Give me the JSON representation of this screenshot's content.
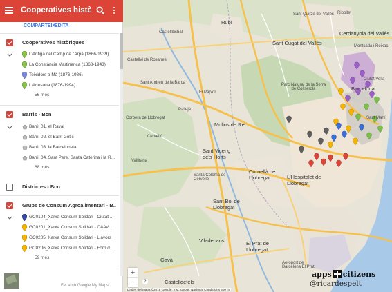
{
  "app": {
    "title": "Cooperatives històriq",
    "actions": {
      "share": "COMPARTEIX",
      "edit": "EDITA"
    }
  },
  "layers": [
    {
      "name": "Cooperatives històriques",
      "checked": true,
      "items": [
        {
          "label": "L'Antiga del Camp de l'Arpa (1866-1939)",
          "color": "#8bc34a"
        },
        {
          "label": "La Constància Martinenca (1868-1943)",
          "color": "#8bc34a"
        },
        {
          "label": "Teixidors a Mà (1876-1986)",
          "color": "#7e86d6"
        },
        {
          "label": "L'Artesana (1876-1994)",
          "color": "#8bc34a"
        }
      ],
      "more": "56 més"
    },
    {
      "name": "Barris - Bcn",
      "checked": true,
      "items": [
        {
          "label": "Barri: 01. el Raval",
          "color": "#bdbdbd"
        },
        {
          "label": "Barri: 02. el Barri Gòtic",
          "color": "#bdbdbd"
        },
        {
          "label": "Barri: 03. la Barceloneta",
          "color": "#bdbdbd"
        },
        {
          "label": "Barri: 04. Sant Pere, Santa Caterina i la R...",
          "color": "#bdbdbd"
        }
      ],
      "more": "68 més"
    },
    {
      "name": "Districtes - Bcn",
      "checked": false,
      "items": [],
      "more": ""
    },
    {
      "name": "Grups de Consum Agroalimentari - B...",
      "checked": true,
      "items": [
        {
          "label": "GC0104_Xarxa Consum Solidari - Ciutat ...",
          "color": "#3949ab"
        },
        {
          "label": "GC0201_Xarxa Consum Solidari - CAAV...",
          "color": "#f4b400"
        },
        {
          "label": "GC0205_Xarxa Consum Solidari - Llavors",
          "color": "#f4b400"
        },
        {
          "label": "GC0206_Xarxa Consum Solidari - Forn d...",
          "color": "#f4b400"
        }
      ],
      "more": "59 més"
    }
  ],
  "footer": {
    "text": "Fet amb Google My Maps"
  },
  "map": {
    "labels": {
      "rubi": "Rubí",
      "castellbisbal": "Castellbisbal",
      "sant_quirze": "Sant Quirze del Vallès",
      "sant_cugat": "Sant Cugat del Vallès",
      "cerdanyola": "Cerdanyola del Vallès",
      "ripollet": "Ripollet",
      "montcada": "Montcada i Reixac",
      "el_papiol": "El Papiol",
      "sant_andreu_barca": "Sant Andreu de la Barca",
      "castellvi": "Castellví de Rosanes",
      "corbera": "Corbera de Llobregat",
      "cervello": "Cervelló",
      "pallejà": "Pallejà",
      "molins": "Molins de Rei",
      "vallirana": "Vallirana",
      "collserola": "Parc Natural de la Serra de Collserola",
      "sant_vicenc": "Sant Vicenç dels Horts",
      "santa_coloma": "Santa Coloma de Cervelló",
      "sant_boi": "Sant Boi de Llobregat",
      "cornella": "Cornellà de Llobregat",
      "hospitalet": "L'Hospitalet de Llobregat",
      "viladecans": "Viladecans",
      "gava": "Gavà",
      "castelldefels": "Castelldefels",
      "el_prat": "El Prat de Llobregat",
      "aeroport": "Aeroport de Barcelona El Prat",
      "barcelona": "Barcelona",
      "ciutat_vella": "Ciutat Vella",
      "sant_marti": "Sant Martí"
    },
    "zoom_in": "+",
    "zoom_out": "−",
    "help": "?",
    "attribution": "Dades del mapa ©2015 Google, Inst. Geogr. Nacional   Condicions   500 m"
  },
  "branding": {
    "name_left": "apps",
    "name_right": "citizens",
    "handle": "@ricardespelt"
  }
}
